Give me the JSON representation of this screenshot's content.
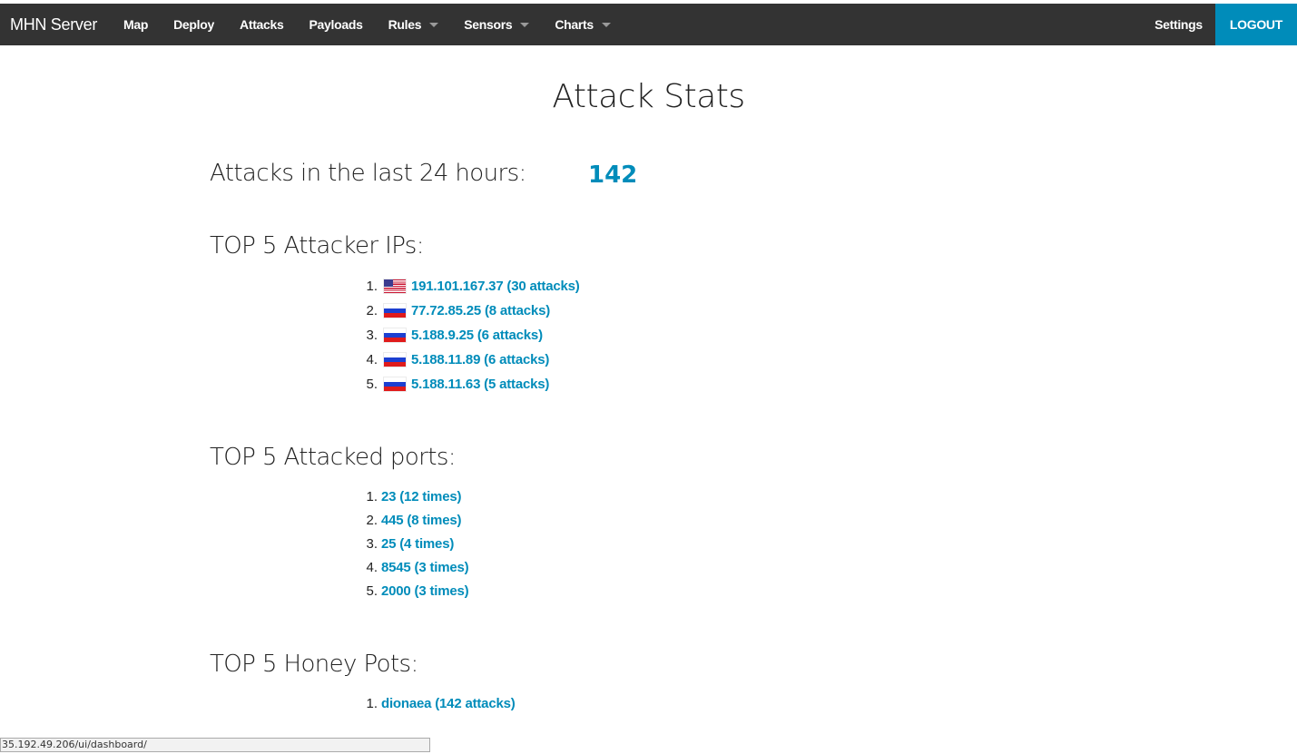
{
  "navbar": {
    "brand": "MHN Server",
    "items": [
      {
        "label": "Map",
        "dropdown": false
      },
      {
        "label": "Deploy",
        "dropdown": false
      },
      {
        "label": "Attacks",
        "dropdown": false
      },
      {
        "label": "Payloads",
        "dropdown": false
      },
      {
        "label": "Rules",
        "dropdown": true
      },
      {
        "label": "Sensors",
        "dropdown": true
      },
      {
        "label": "Charts",
        "dropdown": true
      }
    ],
    "settings_label": "Settings",
    "logout_label": "LOGOUT"
  },
  "page": {
    "title": "Attack Stats",
    "attacks_24h_label": "Attacks in the last 24 hours:",
    "attacks_24h_value": "142",
    "top_ips": {
      "heading": "TOP 5 Attacker IPs:",
      "items": [
        {
          "rank": "1.",
          "flag": "us-flag-icon",
          "text": "191.101.167.37 (30 attacks)"
        },
        {
          "rank": "2.",
          "flag": "ru-flag-icon",
          "text": "77.72.85.25 (8 attacks)"
        },
        {
          "rank": "3.",
          "flag": "ru-flag-icon",
          "text": "5.188.9.25 (6 attacks)"
        },
        {
          "rank": "4.",
          "flag": "ru-flag-icon",
          "text": "5.188.11.89 (6 attacks)"
        },
        {
          "rank": "5.",
          "flag": "ru-flag-icon",
          "text": "5.188.11.63 (5 attacks)"
        }
      ]
    },
    "top_ports": {
      "heading": "TOP 5 Attacked ports:",
      "items": [
        {
          "rank": "1.",
          "text": "23 (12 times)"
        },
        {
          "rank": "2.",
          "text": "445 (8 times)"
        },
        {
          "rank": "3.",
          "text": "25 (4 times)"
        },
        {
          "rank": "4.",
          "text": "8545 (3 times)"
        },
        {
          "rank": "5.",
          "text": "2000 (3 times)"
        }
      ]
    },
    "top_honeypots": {
      "heading": "TOP 5 Honey Pots:",
      "items": [
        {
          "rank": "1.",
          "text": "dionaea (142 attacks)"
        }
      ]
    }
  },
  "status_bar": {
    "url": "35.192.49.206/ui/dashboard/"
  },
  "colors": {
    "navbar_bg": "#333333",
    "accent": "#008cba",
    "link": "#008cba"
  }
}
